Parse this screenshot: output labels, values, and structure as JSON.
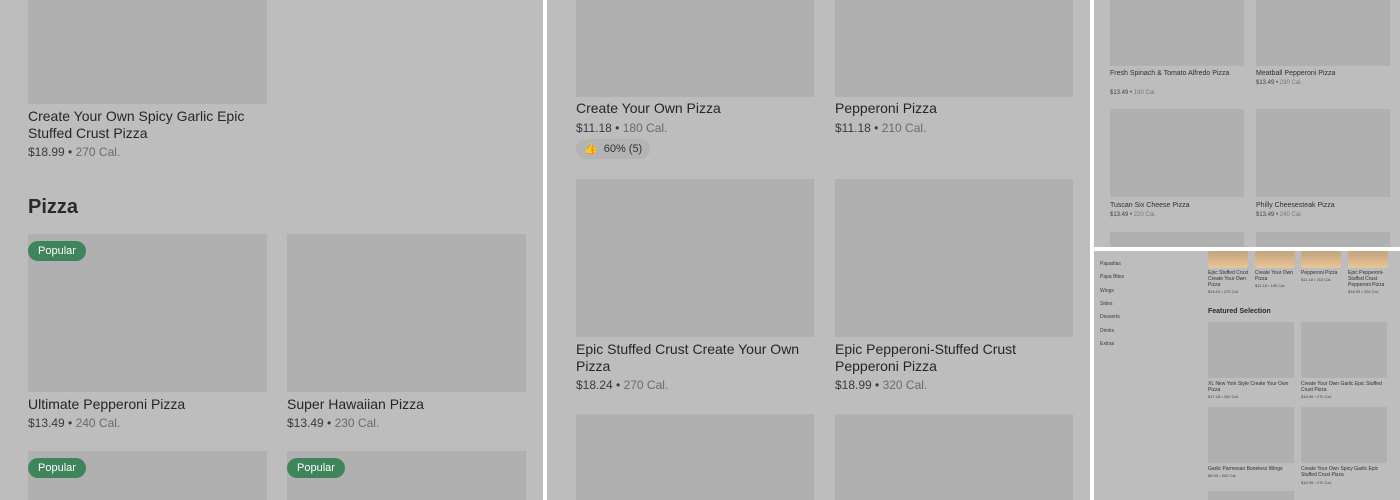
{
  "panel1": {
    "top_item": {
      "title": "Create Your Own Spicy Garlic Epic Stuffed Crust Pizza",
      "price": "$18.99",
      "cal": "270 Cal."
    },
    "section_heading": "Pizza",
    "items": [
      {
        "badge": "Popular",
        "title": "Ultimate Pepperoni Pizza",
        "price": "$13.49",
        "cal": "240 Cal."
      },
      {
        "badge": "",
        "title": "Super Hawaiian Pizza",
        "price": "$13.49",
        "cal": "230 Cal."
      }
    ],
    "bottom_badges": [
      "Popular",
      "Popular"
    ]
  },
  "panel2": {
    "items": [
      {
        "title": "Create Your Own Pizza",
        "price": "$11.18",
        "cal": "180 Cal.",
        "rating": "60% (5)"
      },
      {
        "title": "Pepperoni Pizza",
        "price": "$11.18",
        "cal": "210 Cal."
      },
      {
        "title": "Epic Stuffed Crust Create Your Own Pizza",
        "price": "$18.24",
        "cal": "270 Cal."
      },
      {
        "title": "Epic Pepperoni-Stuffed Crust Pepperoni Pizza",
        "price": "$18.99",
        "cal": "320 Cal."
      }
    ]
  },
  "panel3": {
    "items": [
      {
        "title": "Fresh Spinach & Tomato Alfredo Pizza",
        "price": "$13.49",
        "cal": "190 Cal."
      },
      {
        "title": "Meatball Pepperoni Pizza",
        "price": "$13.49",
        "cal": "230 Cal."
      },
      {
        "title": "Tuscan Six Cheese Pizza",
        "price": "$13.49",
        "cal": "220 Cal."
      },
      {
        "title": "Philly Cheesesteak Pizza",
        "price": "$13.49",
        "cal": "240 Cal."
      }
    ]
  },
  "panel4": {
    "sidebar": [
      "Papadias",
      "Papa Bites",
      "Wings",
      "Sides",
      "Desserts",
      "Drinks",
      "Extras"
    ],
    "top_row": [
      {
        "title": "Epic Stuffed Crust Create Your Own Pizza",
        "price": "$18.24",
        "cal": "270 Cal."
      },
      {
        "title": "Create Your Own Pizza",
        "price": "$11.18",
        "cal": "180 Cal."
      },
      {
        "title": "Pepperoni Pizza",
        "price": "$11.18",
        "cal": "210 Cal."
      },
      {
        "title": "Epic Pepperoni-Stuffed Crust Pepperoni Pizza",
        "price": "$18.99",
        "cal": "320 Cal."
      }
    ],
    "featured_heading": "Featured Selection",
    "featured": [
      {
        "title": "XL New York Style Create Your Own Pizza",
        "price": "$17.18",
        "cal": "300 Cal."
      },
      {
        "title": "Create Your Own Garlic Epic Stuffed Crust Pizza",
        "price": "$18.99",
        "cal": "270 Cal."
      },
      {
        "title": "Garlic Parmesan Boneless Wings",
        "price": "$9.99",
        "cal": "600 Cal."
      },
      {
        "title": "Create Your Own Spicy Garlic Epic Stuffed Crust Pizza",
        "price": "$18.99",
        "cal": "270 Cal."
      }
    ]
  },
  "colors": {
    "overlay": "#bdbdbd",
    "placeholder": "#b0b0b0",
    "badge": "#3f855b"
  }
}
